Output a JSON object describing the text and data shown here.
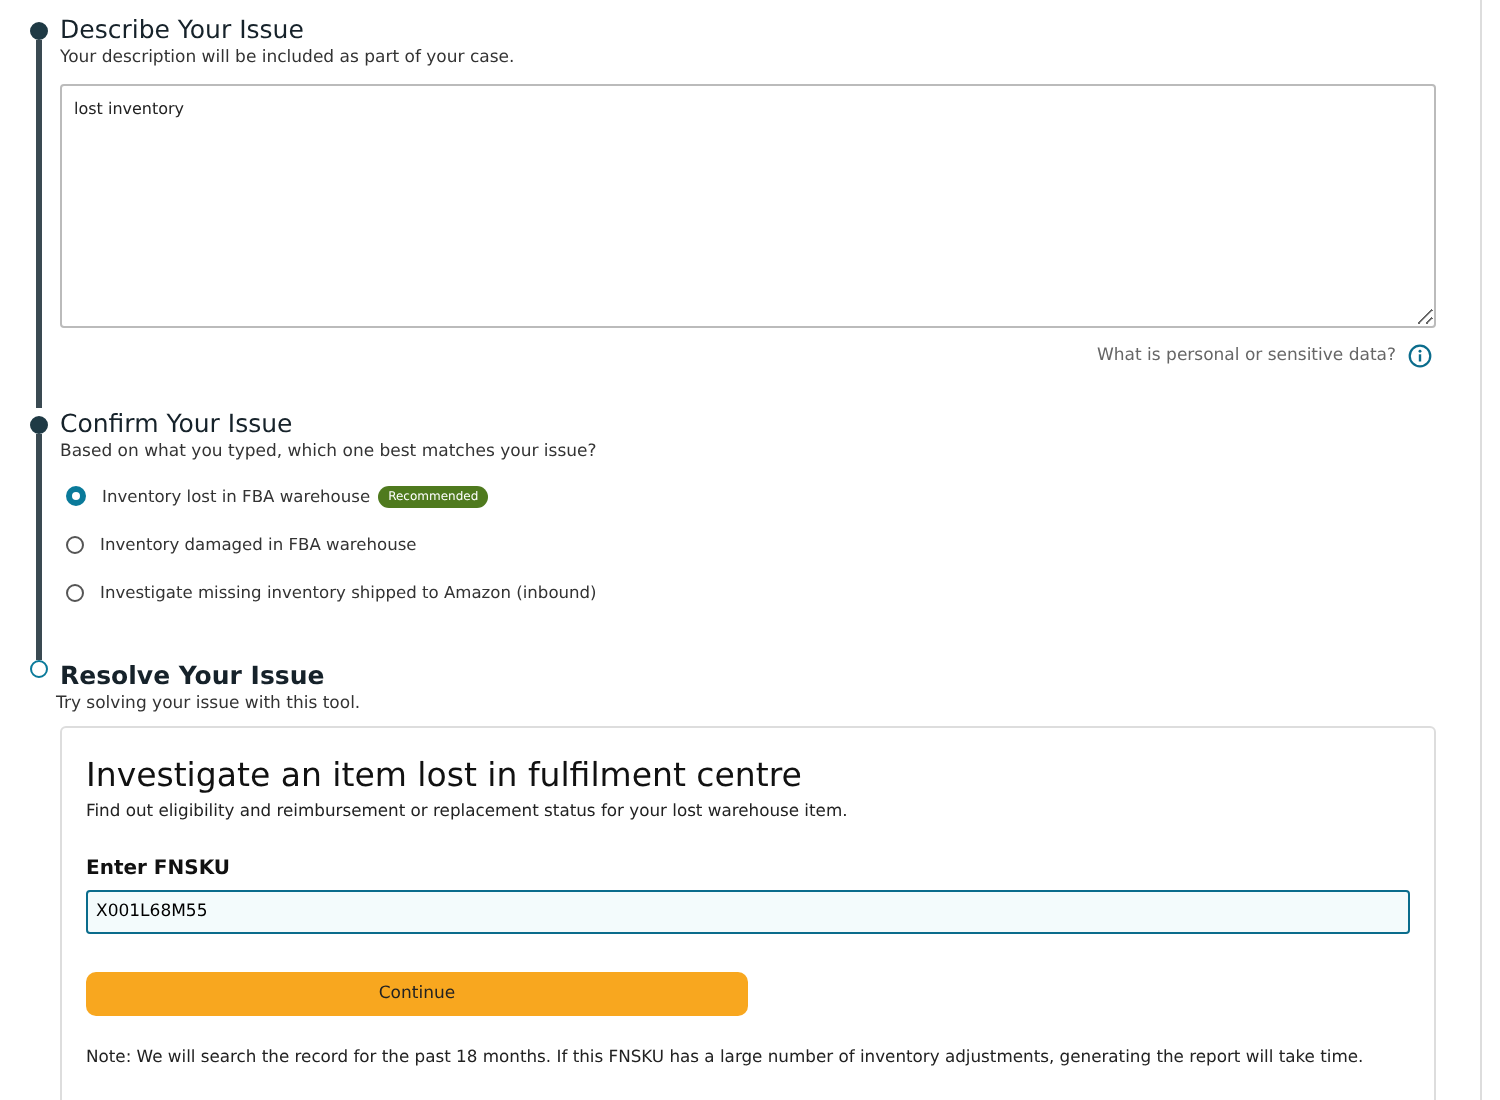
{
  "steps": [
    {
      "title": "Describe Your Issue",
      "subtitle": "Your description will be included as part of your case.",
      "completed": true,
      "kind": "description",
      "value": "lost inventory",
      "hint": "What is personal or sensitive data?"
    },
    {
      "title": "Confirm Your Issue",
      "subtitle": "Based on what you typed, which one best matches your issue?",
      "completed": true,
      "kind": "choices",
      "options": [
        {
          "label": "Inventory lost in FBA warehouse",
          "selected": true,
          "badge": "Recommended"
        },
        {
          "label": "Inventory damaged in FBA warehouse",
          "selected": false
        },
        {
          "label": "Investigate missing inventory shipped to Amazon (inbound)",
          "selected": false
        }
      ]
    },
    {
      "title": "Resolve Your Issue",
      "subtitle": "Try solving your issue with this tool.",
      "completed": false,
      "kind": "tool",
      "card": {
        "title": "Investigate an item lost in fulfilment centre",
        "description": "Find out eligibility and reimbursement or replacement status for your lost warehouse item.",
        "field_label": "Enter FNSKU",
        "field_value": "X001L68M55",
        "button": "Continue",
        "note": "Note: We will search the record for the past 18 months. If this FNSKU has a large number of inventory adjustments, generating the report will take time."
      }
    }
  ]
}
